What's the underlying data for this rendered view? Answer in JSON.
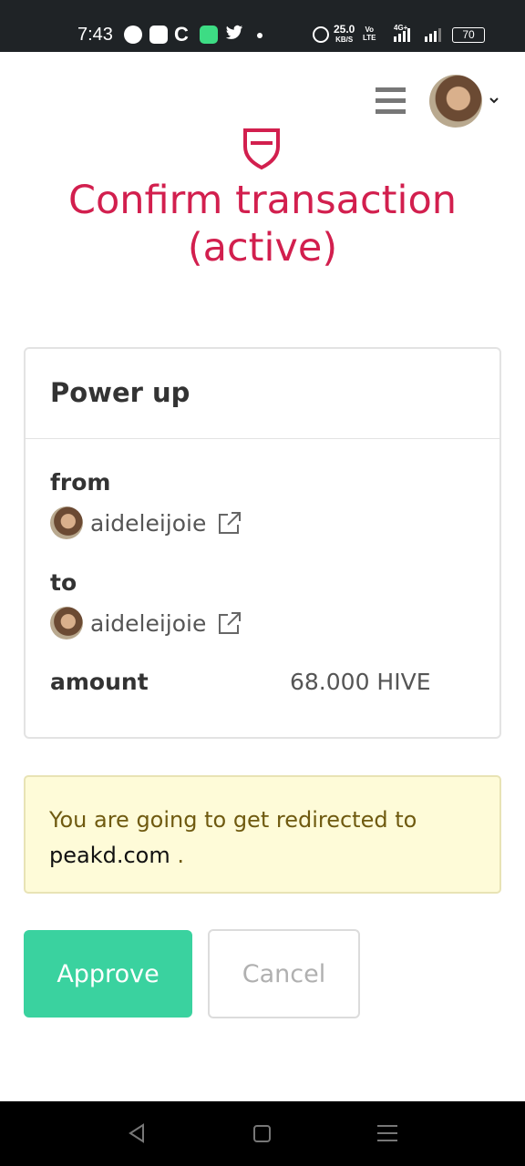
{
  "status_bar": {
    "time": "7:43",
    "speed_value": "25.0",
    "speed_unit": "KB/S",
    "volte_top": "Vo",
    "volte_bottom": "LTE",
    "network": "4G+",
    "battery": "70",
    "icons": [
      "messenger-icon",
      "photos-icon",
      "c-icon",
      "chat-icon",
      "twitter-icon",
      "alarm-icon"
    ]
  },
  "header": {
    "menu_icon": "hamburger-icon",
    "dropdown_icon": "chevron-down-icon"
  },
  "page": {
    "title_line1": "Confirm transaction",
    "title_line2": "(active)",
    "accent_color": "#d21f4e"
  },
  "operation": {
    "title": "Power up",
    "from_label": "from",
    "from_user": "aideleijoie",
    "to_label": "to",
    "to_user": "aideleijoie",
    "amount_label": "amount",
    "amount_value": "68.000 HIVE"
  },
  "notice": {
    "text": "You are going to get redirected to",
    "domain": "peakd.com",
    "suffix": " ."
  },
  "actions": {
    "approve_label": "Approve",
    "cancel_label": "Cancel",
    "approve_color": "#3ad29f"
  },
  "nav": {
    "icons": [
      "back-icon",
      "home-icon",
      "recents-icon"
    ]
  }
}
